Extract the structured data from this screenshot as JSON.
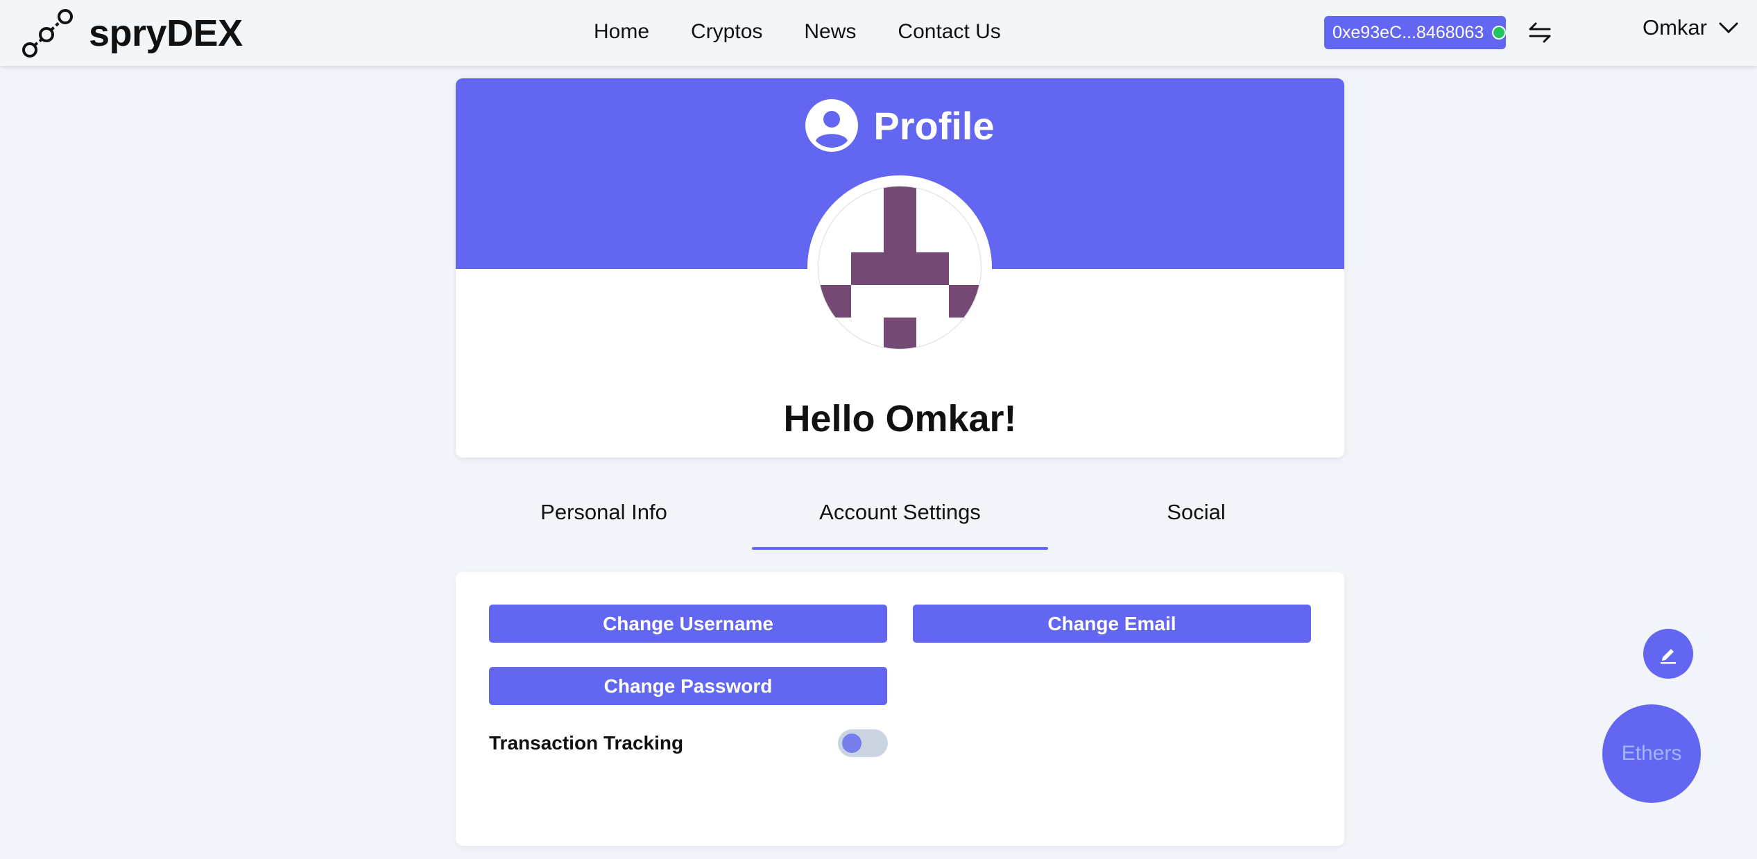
{
  "brand": {
    "name": "spryDEX",
    "logo_icon": "chain-link-icon"
  },
  "nav": {
    "links": [
      {
        "label": "Home"
      },
      {
        "label": "Cryptos"
      },
      {
        "label": "News"
      },
      {
        "label": "Contact Us"
      }
    ]
  },
  "wallet": {
    "address": "0xe93eC...8468063",
    "status_color": "#22c55e"
  },
  "user_menu": {
    "name": "Omkar"
  },
  "profile": {
    "title": "Profile",
    "greeting": "Hello Omkar!",
    "avatar_color": "#744a75",
    "banner_color": "#6366f1"
  },
  "tabs": [
    {
      "label": "Personal Info"
    },
    {
      "label": "Account Settings",
      "active": true
    },
    {
      "label": "Social"
    }
  ],
  "settings": {
    "change_username": "Change Username",
    "change_email": "Change Email",
    "change_password": "Change Password",
    "transaction_tracking": {
      "label": "Transaction Tracking",
      "enabled": false
    }
  },
  "floating": {
    "ethers_label": "Ethers",
    "edit_icon": "pencil-icon"
  },
  "colors": {
    "accent": "#6366f1",
    "background": "#f1f5f9"
  }
}
